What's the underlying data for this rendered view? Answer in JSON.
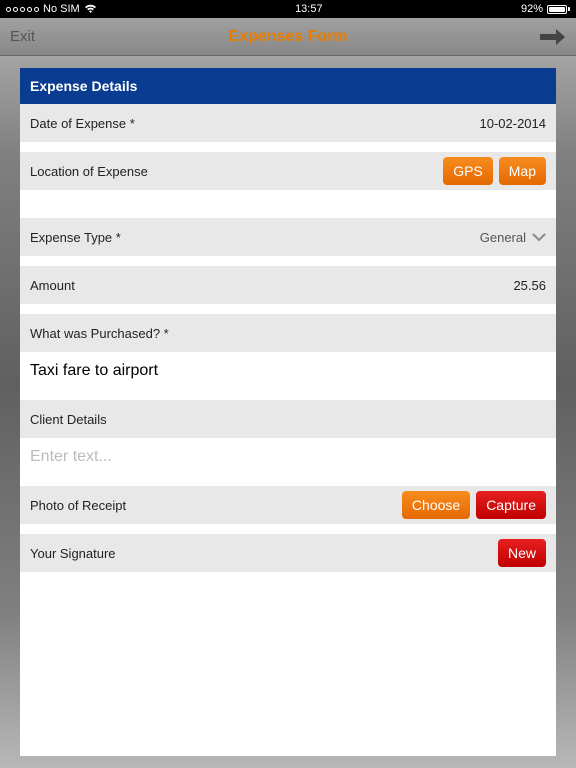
{
  "status": {
    "carrier": "No SIM",
    "time": "13:57",
    "battery_pct": "92%"
  },
  "nav": {
    "exit": "Exit",
    "title": "Expenses Form"
  },
  "section_header": "Expense Details",
  "rows": {
    "date": {
      "label": "Date of Expense *",
      "value": "10-02-2014"
    },
    "location": {
      "label": "Location of Expense",
      "gps": "GPS",
      "map": "Map"
    },
    "type": {
      "label": "Expense Type *",
      "value": "General"
    },
    "amount": {
      "label": "Amount",
      "value": "25.56"
    },
    "purchased": {
      "label": "What was Purchased? *",
      "value": "Taxi fare to airport"
    },
    "client": {
      "label": "Client Details",
      "placeholder": "Enter text..."
    },
    "photo": {
      "label": "Photo of Receipt",
      "choose": "Choose",
      "capture": "Capture"
    },
    "signature": {
      "label": "Your Signature",
      "new": "New"
    }
  }
}
